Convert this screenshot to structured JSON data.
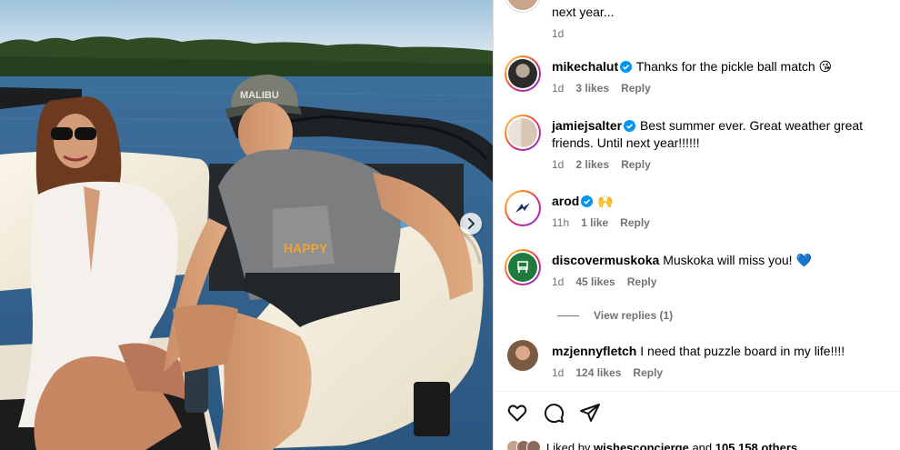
{
  "comments": [
    {
      "username": "",
      "text": "next year...",
      "time": "1d",
      "likes": "",
      "reply": ""
    },
    {
      "username": "mikechalut",
      "verified": true,
      "text": "Thanks for the pickle ball match 😘",
      "time": "1d",
      "likes": "3 likes",
      "reply": "Reply"
    },
    {
      "username": "jamiejsalter",
      "verified": true,
      "text": "Best summer ever. Great weather great friends. Until next year!!!!!!",
      "time": "1d",
      "likes": "2 likes",
      "reply": "Reply"
    },
    {
      "username": "arod",
      "verified": true,
      "text": "🙌",
      "time": "11h",
      "likes": "1 like",
      "reply": "Reply"
    },
    {
      "username": "discovermuskoka",
      "verified": false,
      "text": "Muskoka will miss you! 💙",
      "time": "1d",
      "likes": "45 likes",
      "reply": "Reply"
    },
    {
      "username": "mzjennyfletch",
      "verified": false,
      "text": "I need that puzzle board in my life!!!!",
      "time": "1d",
      "likes": "124 likes",
      "reply": "Reply"
    }
  ],
  "view_replies": "View replies (1)",
  "liked_by": {
    "prefix": "Liked by",
    "user": "wishesconcierge",
    "middle": "and",
    "count": "105,158 others"
  },
  "photo": {
    "cap_text": "MALIBU",
    "shirt_text": "HAPPY"
  },
  "colors": {
    "verified": "#0095f6",
    "meta": "#737373",
    "lake": "#2f5f8f",
    "sky": "#a7c7dd"
  },
  "icons": [
    "heart-icon",
    "comment-icon",
    "share-icon",
    "chevron-right-icon",
    "verified-badge-icon"
  ]
}
